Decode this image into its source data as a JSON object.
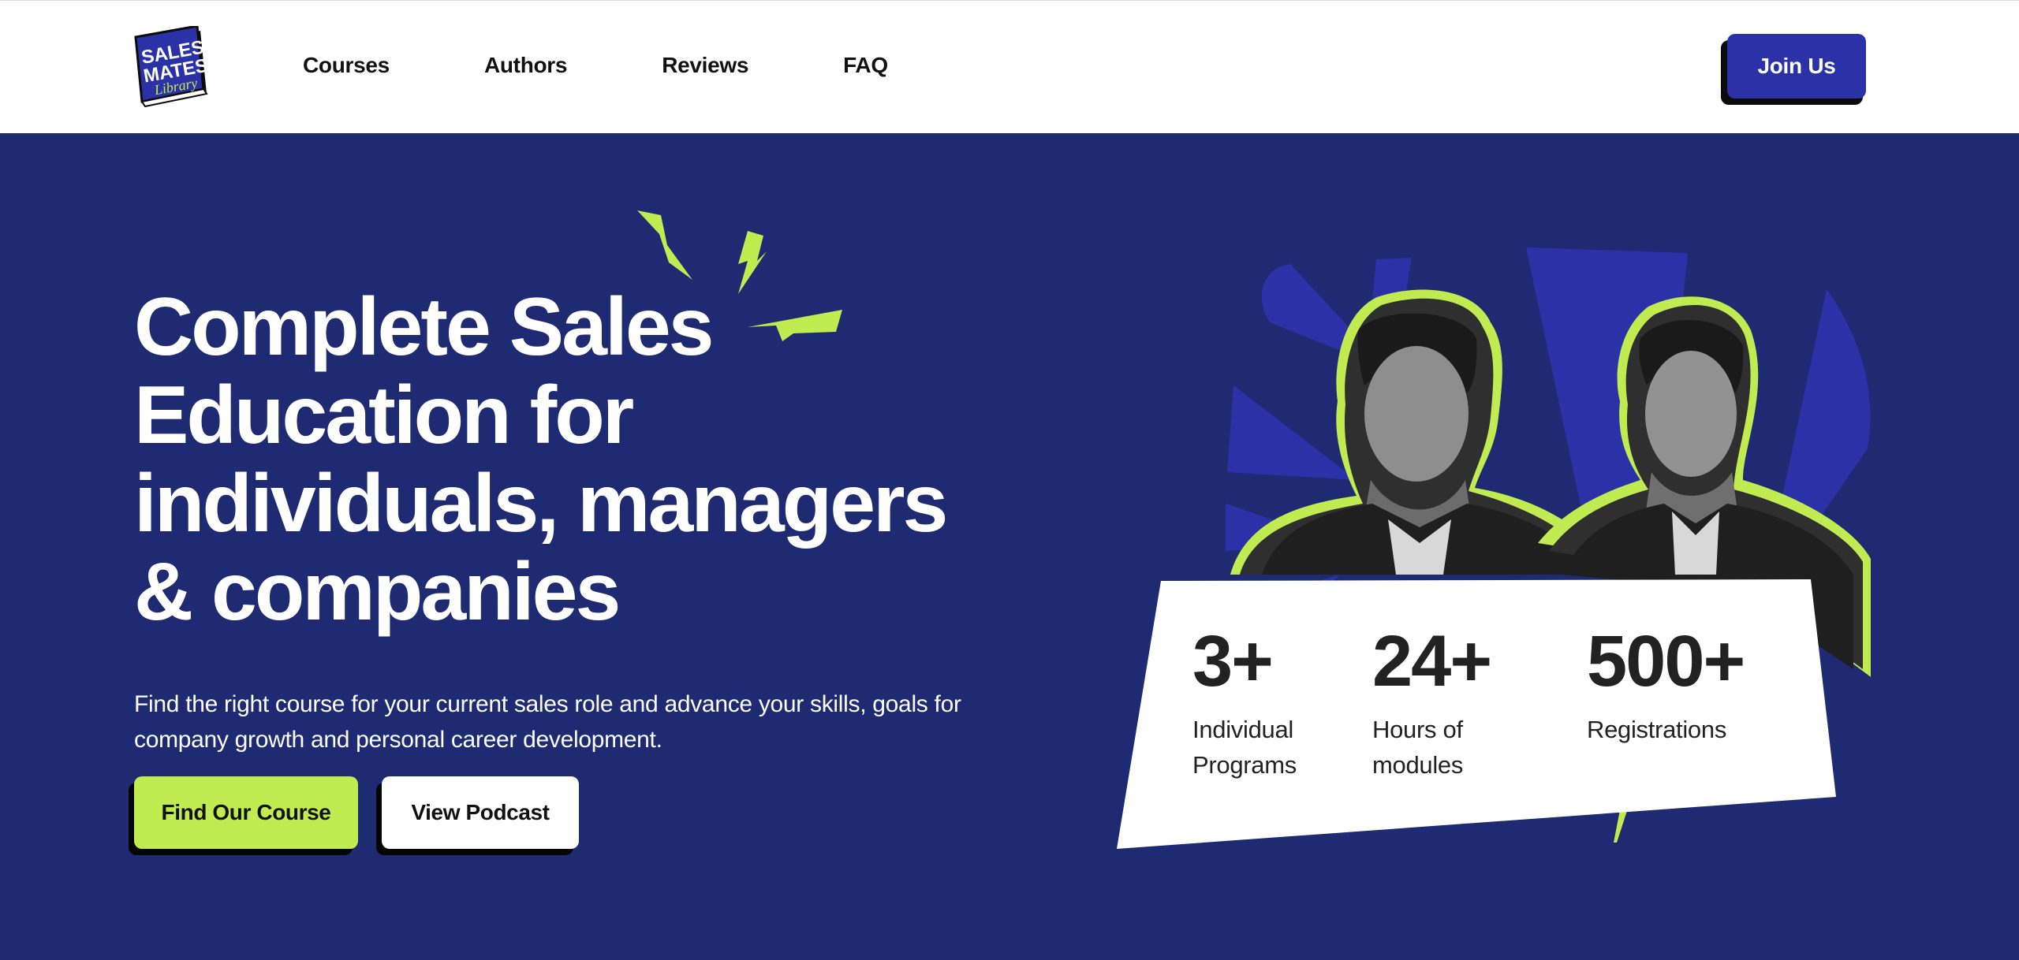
{
  "brand": {
    "logo_line1": "SALES",
    "logo_line2": "MATES",
    "logo_line3": "Library"
  },
  "nav": {
    "items": [
      "Courses",
      "Authors",
      "Reviews",
      "FAQ"
    ]
  },
  "header": {
    "join_label": "Join Us"
  },
  "hero": {
    "headline_lines": [
      "Complete Sales",
      "Education for",
      "individuals, managers",
      "& companies"
    ],
    "subtext": "Find the right course for your current sales role and advance your skills, goals for company growth and personal career development.",
    "primary_button": "Find Our Course",
    "secondary_button": "View Podcast"
  },
  "stats": [
    {
      "value": "3+",
      "label": "Individual Programs"
    },
    {
      "value": "24+",
      "label": "Hours of modules"
    },
    {
      "value": "500+",
      "label": "Registrations"
    }
  ],
  "colors": {
    "navy": "#1e2a72",
    "blue_accent": "#2b32a7",
    "lime": "#c0ec52",
    "white": "#ffffff",
    "dark": "#0b0b0b"
  },
  "icons": [
    "lightning-bolt-icon",
    "logo-book-icon"
  ]
}
